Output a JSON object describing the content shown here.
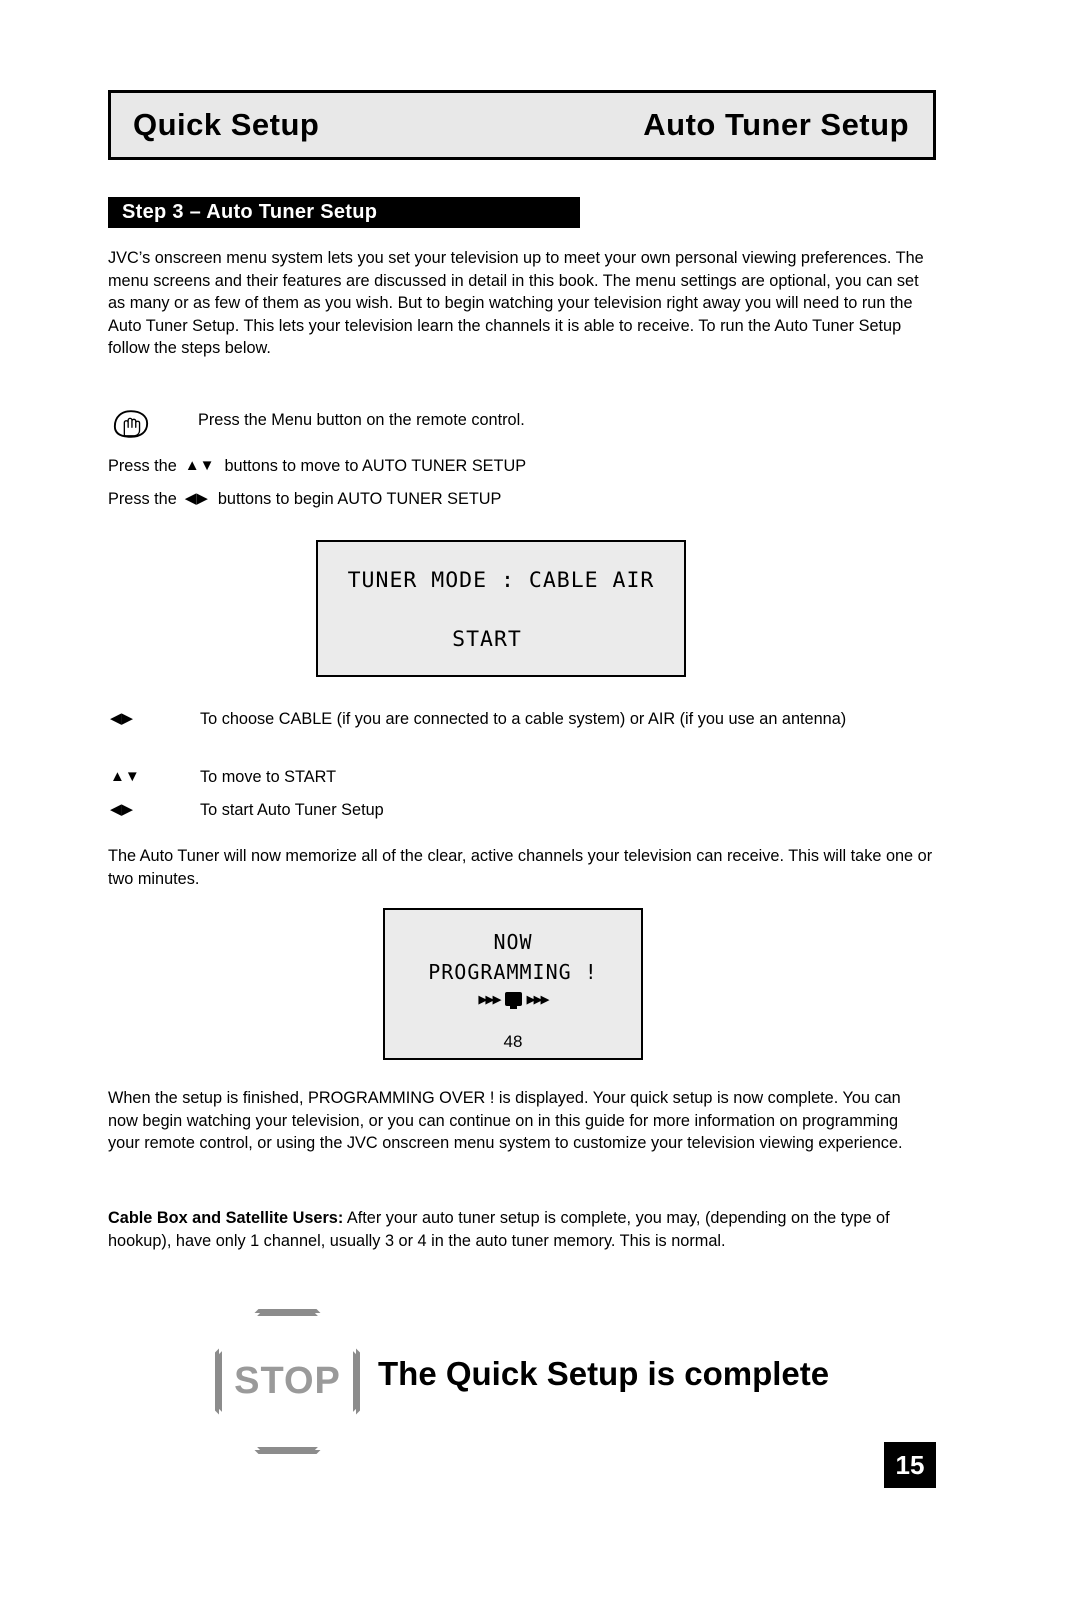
{
  "header": {
    "left_title": "Quick Setup",
    "right_title": "Auto Tuner Setup"
  },
  "step": {
    "title": "Step 3 – Auto Tuner Setup"
  },
  "intro_paragraph": "JVC’s onscreen menu system lets you set your television up to meet your own personal viewing preferences. The menu screens and their features are discussed in detail in this book. The menu settings are optional, you can set as many or as few of them as you wish. But to begin watching your television right away you will need to run the Auto Tuner Setup. This lets your television learn the channels it is able to receive. To run the Auto Tuner Setup follow the steps below.",
  "instructions": {
    "menu_button": "Press the Menu button on the remote control.",
    "updown_prefix": "Press the",
    "updown_glyphs": "▲▼",
    "updown_suffix": "buttons to move to AUTO TUNER SETUP",
    "leftright_prefix": "Press the",
    "leftright_glyphs": "◀▶",
    "leftright_suffix": "buttons to begin AUTO TUNER SETUP"
  },
  "osd_tuner": {
    "line1": "TUNER MODE  :   CABLE  AIR",
    "line2": "START"
  },
  "arrow_rows": [
    {
      "glyphs": "◀▶",
      "text": "To choose CABLE (if you are connected to a cable system) or AIR (if you use an antenna)"
    },
    {
      "glyphs": "▲▼",
      "text": "To move to START"
    },
    {
      "glyphs": "◀▶",
      "text": "To start Auto Tuner Setup"
    }
  ],
  "after_tuner_paragraph": "The Auto Tuner will now memorize all of the clear, active channels your television can receive. This will take one or two minutes.",
  "osd_now": {
    "line1": "NOW",
    "line2": "PROGRAMMING !",
    "left_triangles": "▶▶▶",
    "right_triangles": "▶▶▶",
    "number": "48"
  },
  "finish_paragraph": "When the setup is finished, PROGRAMMING OVER ! is displayed. Your quick setup is now complete. You can now begin watching your television, or you can continue on in this guide for more information on programming your remote control, or using the JVC onscreen menu system to customize your television viewing experience.",
  "cable_box": {
    "bold_lead": "Cable Box and Satellite Users:",
    "rest": " After your auto tuner setup is complete, you may, (depending on the type of hookup), have only 1 channel, usually 3 or 4 in the auto tuner memory.  This is normal."
  },
  "stop_sign": {
    "label": "STOP",
    "message": "The Quick Setup is complete"
  },
  "page_number": "15"
}
